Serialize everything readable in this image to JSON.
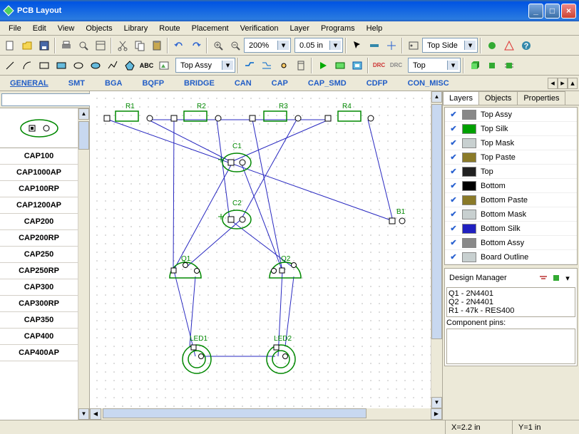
{
  "window": {
    "title": "PCB Layout"
  },
  "menu": [
    "File",
    "Edit",
    "View",
    "Objects",
    "Library",
    "Route",
    "Placement",
    "Verification",
    "Layer",
    "Programs",
    "Help"
  ],
  "toolbar1": {
    "zoom_value": "200%",
    "grid_value": "0.05 in",
    "side_value": "Top Side"
  },
  "toolbar2": {
    "layer_value": "Top Assy",
    "drc_layer": "Top"
  },
  "category_tabs": [
    "GENERAL",
    "SMT",
    "BGA",
    "BQFP",
    "BRIDGE",
    "CAN",
    "CAP",
    "CAP_SMD",
    "CDFP",
    "CON_MISC"
  ],
  "active_category": "GENERAL",
  "component_list": [
    "CAP100",
    "CAP1000AP",
    "CAP100RP",
    "CAP1200AP",
    "CAP200",
    "CAP200RP",
    "CAP250",
    "CAP250RP",
    "CAP300",
    "CAP300RP",
    "CAP350",
    "CAP400",
    "CAP400AP"
  ],
  "canvas": {
    "components": {
      "R1": "R1",
      "R2": "R2",
      "R3": "R3",
      "R4": "R4",
      "C1": "C1",
      "C2": "C2",
      "Q1": "Q1",
      "Q2": "Q2",
      "LED1": "LED1",
      "LED2": "LED2",
      "B1": "B1"
    }
  },
  "right_tabs": [
    "Layers",
    "Objects",
    "Properties"
  ],
  "active_right_tab": "Layers",
  "layers": [
    {
      "name": "Top Assy",
      "color": "#888888"
    },
    {
      "name": "Top Silk",
      "color": "#00a000"
    },
    {
      "name": "Top Mask",
      "color": "#c8d0d0"
    },
    {
      "name": "Top Paste",
      "color": "#8a7a28"
    },
    {
      "name": "Top",
      "color": "#202020"
    },
    {
      "name": "Bottom",
      "color": "#000000"
    },
    {
      "name": "Bottom Paste",
      "color": "#8a7a28"
    },
    {
      "name": "Bottom Mask",
      "color": "#c8d0d0"
    },
    {
      "name": "Bottom Silk",
      "color": "#2020c0"
    },
    {
      "name": "Bottom Assy",
      "color": "#888888"
    },
    {
      "name": "Board Outline",
      "color": "#c8d0d0"
    }
  ],
  "design_manager": {
    "title": "Design Manager",
    "items": [
      "Q1 - 2N4401",
      "Q2 - 2N4401",
      "R1 - 47k - RES400"
    ],
    "pins_label": "Component pins:"
  },
  "status": {
    "x": "X=2.2 in",
    "y": "Y=1 in"
  }
}
